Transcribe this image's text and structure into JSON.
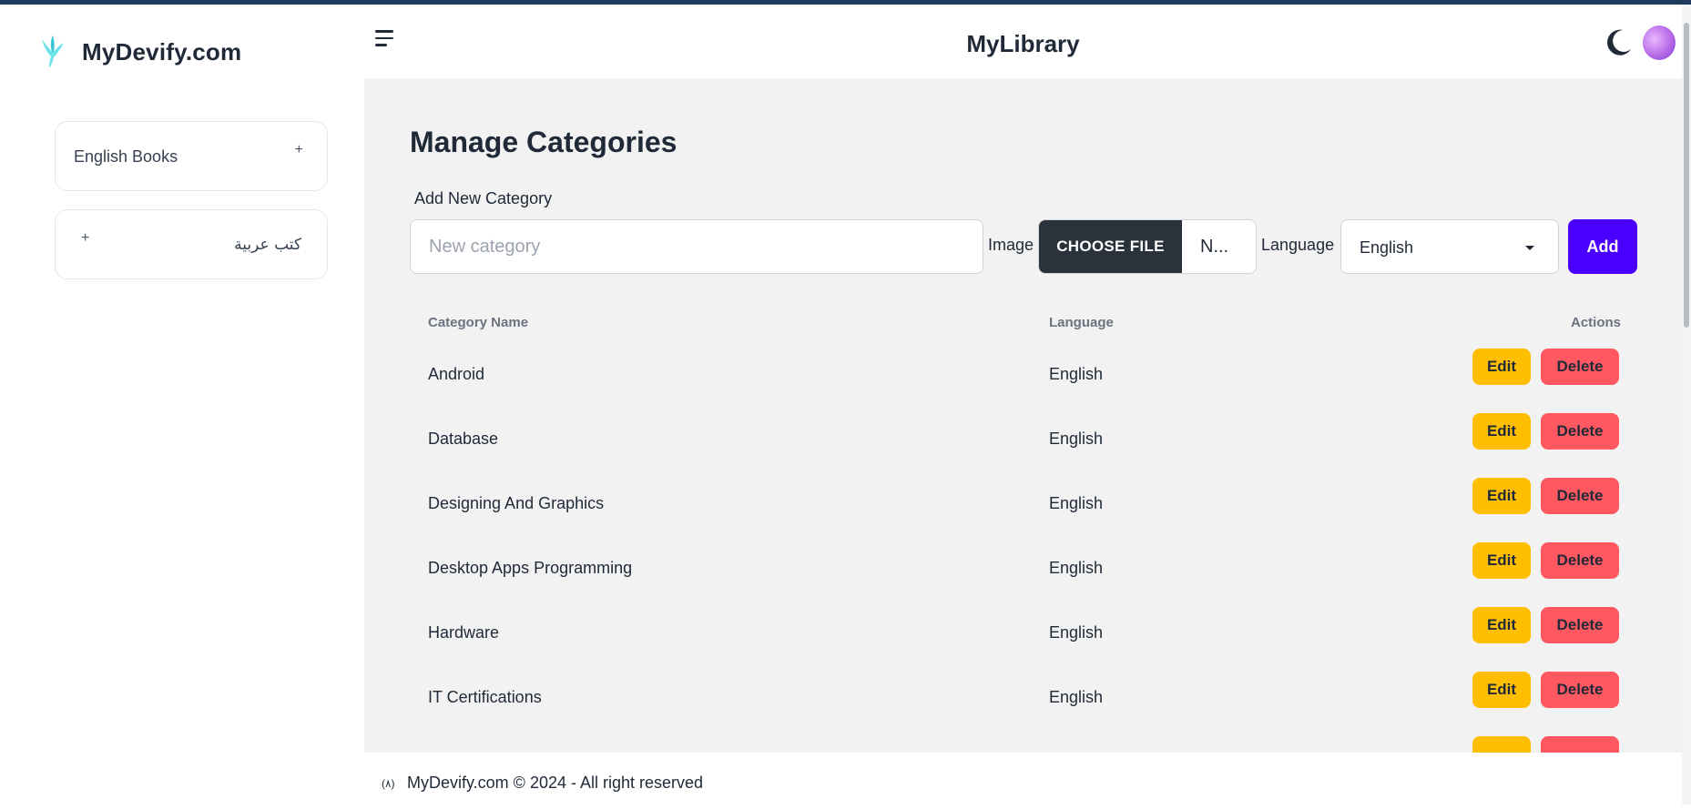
{
  "brand": {
    "name": "MyDevify.com"
  },
  "sidebar": {
    "items": [
      {
        "label": "English Books",
        "toggle": "+"
      },
      {
        "label": "كتب عربية",
        "toggle": "+"
      }
    ]
  },
  "header": {
    "title": "MyLibrary"
  },
  "main": {
    "title": "Manage Categories",
    "form": {
      "label": "Add New Category",
      "input_placeholder": "New category",
      "image_label": "Image",
      "file_button": "CHOOSE FILE",
      "file_name": "N...",
      "language_label": "Language",
      "language_value": "English",
      "add_button": "Add"
    },
    "table": {
      "headers": {
        "name": "Category Name",
        "language": "Language",
        "actions": "Actions"
      },
      "edit_label": "Edit",
      "delete_label": "Delete",
      "rows": [
        {
          "name": "Android",
          "language": "English"
        },
        {
          "name": "Database",
          "language": "English"
        },
        {
          "name": "Designing And Graphics",
          "language": "English"
        },
        {
          "name": "Desktop Apps Programming",
          "language": "English"
        },
        {
          "name": "Hardware",
          "language": "English"
        },
        {
          "name": "IT Certifications",
          "language": "English"
        }
      ]
    }
  },
  "footer": {
    "icon_text": "(٨)",
    "text": "MyDevify.com © 2024 - All right reserved"
  },
  "colors": {
    "accent": "#4a00ff",
    "edit": "#ffbe00",
    "delete": "#ff5861",
    "dark": "#2a323c"
  }
}
